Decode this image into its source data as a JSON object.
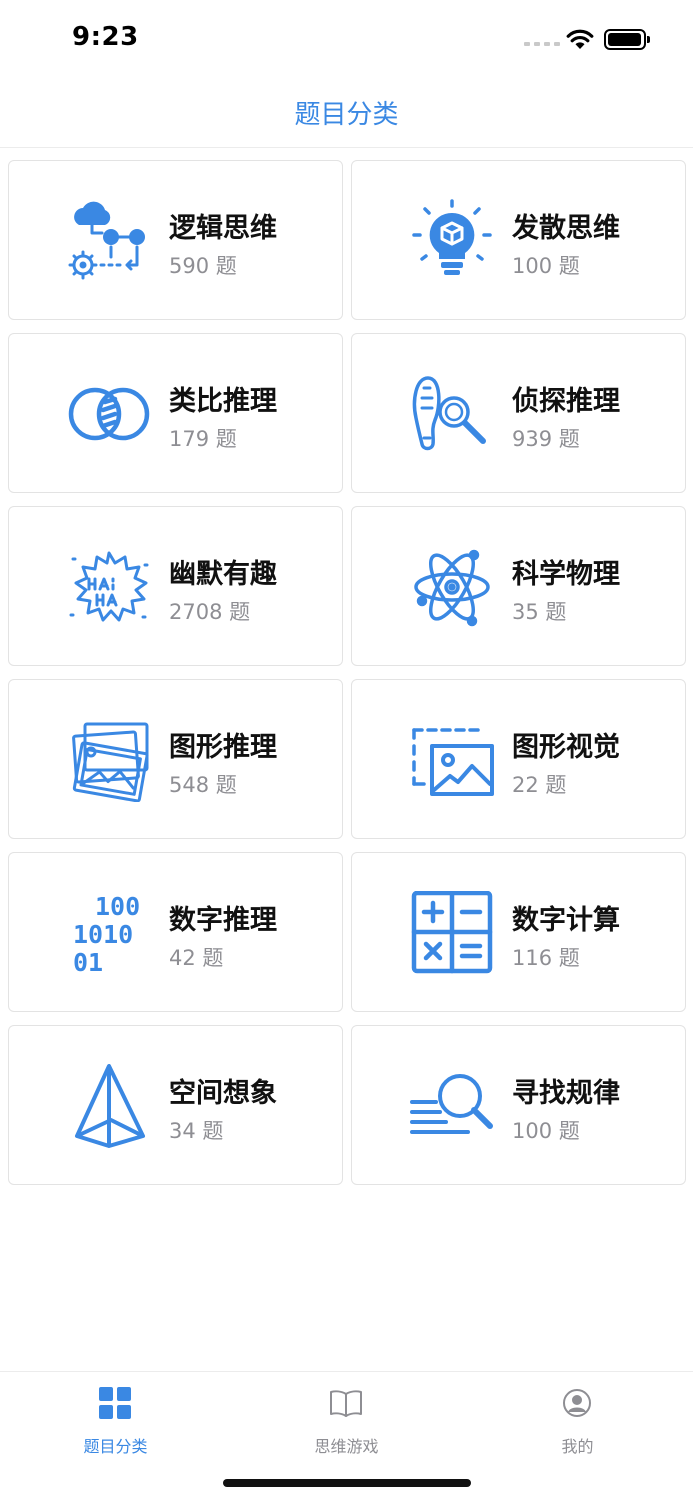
{
  "status_bar": {
    "time": "9:23"
  },
  "header": {
    "title": "题目分类"
  },
  "categories": [
    {
      "name": "逻辑思维",
      "count": "590 题",
      "icon": "logic-flow-icon"
    },
    {
      "name": "发散思维",
      "count": "100 题",
      "icon": "lightbulb-icon"
    },
    {
      "name": "类比推理",
      "count": "179 题",
      "icon": "overlap-circles-icon"
    },
    {
      "name": "侦探推理",
      "count": "939 题",
      "icon": "footprint-magnifier-icon"
    },
    {
      "name": "幽默有趣",
      "count": "2708 题",
      "icon": "haha-burst-icon"
    },
    {
      "name": "科学物理",
      "count": "35 题",
      "icon": "atom-icon"
    },
    {
      "name": "图形推理",
      "count": "548 题",
      "icon": "pictures-stack-icon"
    },
    {
      "name": "图形视觉",
      "count": "22 题",
      "icon": "image-frame-icon"
    },
    {
      "name": "数字推理",
      "count": "42 题",
      "icon": "binary-digits-icon"
    },
    {
      "name": "数字计算",
      "count": "116 题",
      "icon": "calculator-icon"
    },
    {
      "name": "空间想象",
      "count": "34 题",
      "icon": "pyramid-icon"
    },
    {
      "name": "寻找规律",
      "count": "100 题",
      "icon": "search-lines-icon"
    }
  ],
  "tab_bar": {
    "tabs": [
      {
        "label": "题目分类",
        "icon": "grid-icon",
        "active": true
      },
      {
        "label": "思维游戏",
        "icon": "book-icon",
        "active": false
      },
      {
        "label": "我的",
        "icon": "user-icon",
        "active": false
      }
    ]
  },
  "colors": {
    "accent": "#3a88e3",
    "inactive": "#8e8e93",
    "border": "#e3e3e3"
  }
}
